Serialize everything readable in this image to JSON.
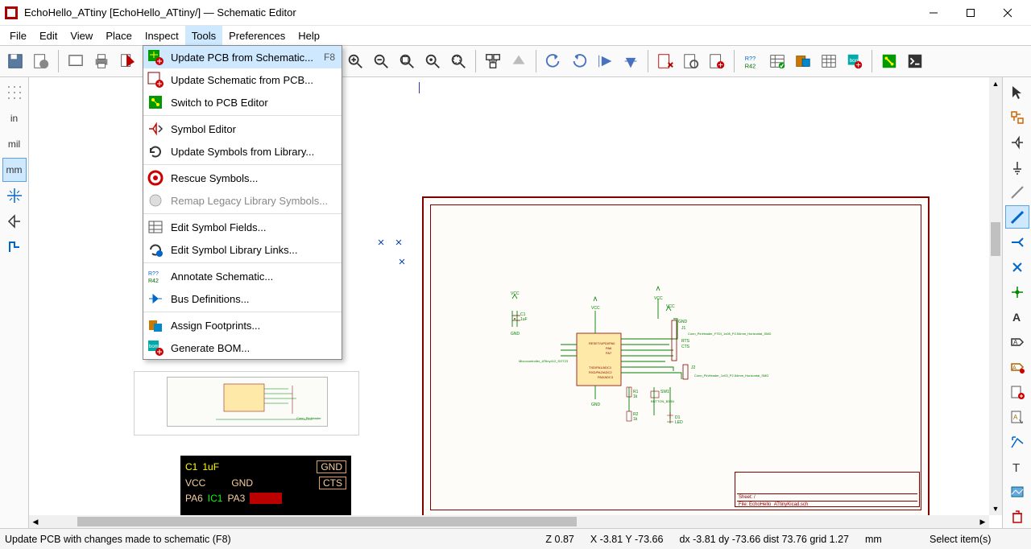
{
  "title": "EchoHello_ATtiny [EchoHello_ATtiny/] — Schematic Editor",
  "menus": [
    "File",
    "Edit",
    "View",
    "Place",
    "Inspect",
    "Tools",
    "Preferences",
    "Help"
  ],
  "activeMenuIndex": 5,
  "dropdown": {
    "items": [
      {
        "label": "Update PCB from Schematic...",
        "accel": "F8",
        "hover": true
      },
      {
        "label": "Update Schematic from PCB..."
      },
      {
        "label": "Switch to PCB Editor"
      },
      {
        "sep": true
      },
      {
        "label": "Symbol Editor"
      },
      {
        "label": "Update Symbols from Library..."
      },
      {
        "sep": true
      },
      {
        "label": "Rescue Symbols..."
      },
      {
        "label": "Remap Legacy Library Symbols...",
        "disabled": true
      },
      {
        "sep": true
      },
      {
        "label": "Edit Symbol Fields..."
      },
      {
        "label": "Edit Symbol Library Links..."
      },
      {
        "sep": true
      },
      {
        "label": "Annotate Schematic..."
      },
      {
        "label": "Bus Definitions..."
      },
      {
        "sep": true
      },
      {
        "label": "Assign Footprints..."
      },
      {
        "label": "Generate BOM..."
      }
    ]
  },
  "leftbar": {
    "items": [
      "grid",
      "in",
      "mil",
      "mm",
      "cross",
      "tri",
      "corner"
    ],
    "mm_label": "mm",
    "mil_label": "mil",
    "in_label": "in"
  },
  "sheet": {
    "titleblock": {
      "row1": "Sheet: /",
      "row2": "File: EchoHello_ATtinyKicad.sch"
    },
    "labels": {
      "vcc1": "VCC",
      "vcc2": "VCC",
      "vcc3": "VCC",
      "gnd": "GND",
      "gnd2": "GND",
      "gnd3": "GND",
      "c1": "C1",
      "c1v": "1uF",
      "mcu": "Microcontroller_ATtiny412_SOT23",
      "reset": "RESET/UPDI/PA0",
      "pa6": "PA6",
      "pa7": "PA7",
      "tx": "TXD/PA1/ADC1",
      "rx": "RXD/PA2/ADC2",
      "pa3": "PA3/ADC3",
      "j1": "J1",
      "j1fp": "Conn_PinHeader_FTDI_1x06_P2.54mm_Horizontal_SMD",
      "j2": "J2",
      "j2fp": "Conn_PinHeader_1x03_P2.54mm_Horizontal_SMD",
      "rts": "RTS",
      "cts": "CTS",
      "r1": "R1",
      "r1v": "1k",
      "sw1": "SW1",
      "sw1n": "BUTTON_B3SN",
      "r2": "R2",
      "r2v": "1k",
      "led": "D1",
      "ledn": "LED"
    }
  },
  "pcbthumb": {
    "c1": "C1",
    "c1v": "1uF",
    "gnd": "GND",
    "vcc": "VCC",
    "pa6": "PA6",
    "ic1": "IC1",
    "pa3": "PA3",
    "cts": "CTS"
  },
  "status": {
    "left": "Update PCB with changes made to schematic  (F8)",
    "z": "Z 0.87",
    "xy": "X -3.81  Y -73.66",
    "dxy": "dx -3.81   dy -73.66   dist 73.76   grid 1.27",
    "unit": "mm",
    "mode": "Select item(s)"
  }
}
